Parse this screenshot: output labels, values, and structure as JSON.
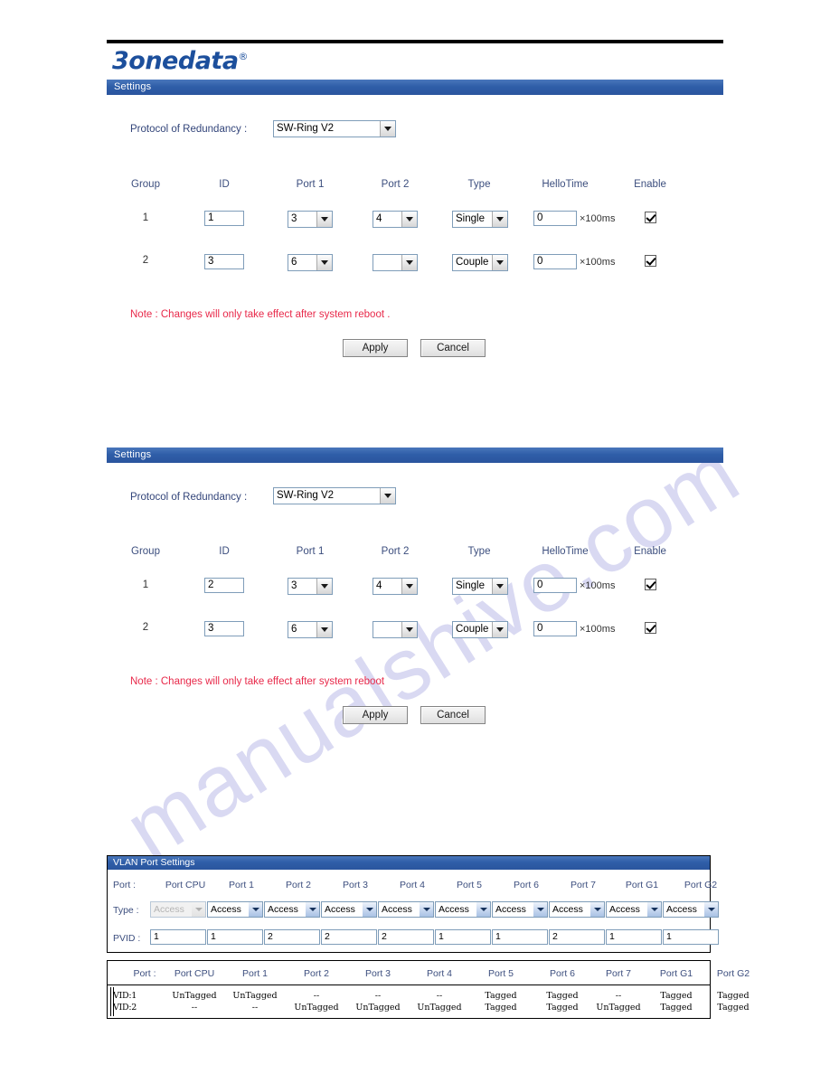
{
  "brand": {
    "name": "3onedata",
    "registered": "®"
  },
  "panels": [
    {
      "title": "Settings",
      "protocol_label": "Protocol of Redundancy :",
      "protocol_value": "SW-Ring V2",
      "columns": [
        "Group",
        "ID",
        "Port 1",
        "Port 2",
        "Type",
        "HelloTime",
        "Enable"
      ],
      "rows": [
        {
          "group": "1",
          "id": "1",
          "port1": "3",
          "port2": "4",
          "type": "Single",
          "hellotime": "0",
          "unit": "×100ms",
          "enable": true
        },
        {
          "group": "2",
          "id": "3",
          "port1": "6",
          "port2": "",
          "type": "Couple",
          "hellotime": "0",
          "unit": "×100ms",
          "enable": true
        }
      ],
      "note": "Note :  Changes will only take effect after system reboot .",
      "apply_label": "Apply",
      "cancel_label": "Cancel"
    },
    {
      "title": "Settings",
      "protocol_label": "Protocol of Redundancy :",
      "protocol_value": "SW-Ring V2",
      "columns": [
        "Group",
        "ID",
        "Port 1",
        "Port 2",
        "Type",
        "HelloTime",
        "Enable"
      ],
      "rows": [
        {
          "group": "1",
          "id": "2",
          "port1": "3",
          "port2": "4",
          "type": "Single",
          "hellotime": "0",
          "unit": "×100ms",
          "enable": true
        },
        {
          "group": "2",
          "id": "3",
          "port1": "6",
          "port2": "",
          "type": "Couple",
          "hellotime": "0",
          "unit": "×100ms",
          "enable": true
        }
      ],
      "note": "Note :  Changes will only take effect after system reboot",
      "apply_label": "Apply",
      "cancel_label": "Cancel"
    }
  ],
  "vlan_port_settings": {
    "title": "VLAN Port Settings",
    "port_row_label": "Port :",
    "type_row_label": "Type :",
    "pvid_row_label": "PVID :",
    "ports": [
      "Port CPU",
      "Port 1",
      "Port 2",
      "Port 3",
      "Port 4",
      "Port 5",
      "Port 6",
      "Port 7",
      "Port G1",
      "Port G2"
    ],
    "types": [
      "Access",
      "Access",
      "Access",
      "Access",
      "Access",
      "Access",
      "Access",
      "Access",
      "Access",
      "Access"
    ],
    "types_disabled": [
      true,
      false,
      false,
      false,
      false,
      false,
      false,
      false,
      false,
      false
    ],
    "pvids": [
      "1",
      "1",
      "2",
      "2",
      "2",
      "1",
      "1",
      "2",
      "1",
      "1"
    ]
  },
  "vlan_membership": {
    "port_row_label": "Port :",
    "ports": [
      "Port CPU",
      "Port 1",
      "Port 2",
      "Port 3",
      "Port 4",
      "Port 5",
      "Port 6",
      "Port 7",
      "Port G1",
      "Port G2"
    ],
    "rows": [
      {
        "vid": "VID:1",
        "values": [
          "UnTagged",
          "UnTagged",
          "--",
          "--",
          "--",
          "Tagged",
          "Tagged",
          "--",
          "Tagged",
          "Tagged"
        ]
      },
      {
        "vid": "VID:2",
        "values": [
          "--",
          "--",
          "UnTagged",
          "UnTagged",
          "UnTagged",
          "Tagged",
          "Tagged",
          "UnTagged",
          "Tagged",
          "Tagged"
        ]
      }
    ]
  },
  "watermark": {
    "text": "manualshive.com",
    "color": "#d9d9f2"
  }
}
